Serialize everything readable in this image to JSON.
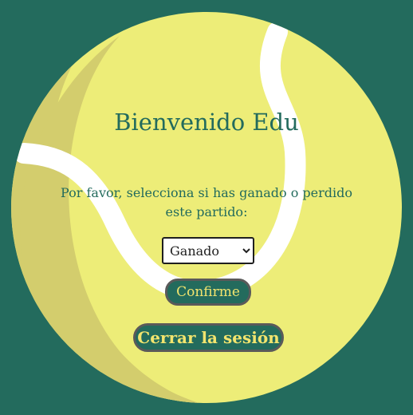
{
  "colors": {
    "background": "#236b5d",
    "ball_yellow": "#eded78",
    "ball_shadow": "#d3cd6d",
    "seam": "#ffffff",
    "text": "#236b5d",
    "button_text": "#f2e46e"
  },
  "icons": {
    "ball": "tennis-ball"
  },
  "welcome": {
    "title": "Bienvenido Edu"
  },
  "result": {
    "prompt": "Por favor, selecciona si has ganado o perdido este partido:",
    "selected_option": "Ganado",
    "options": [
      "Ganado"
    ]
  },
  "actions": {
    "confirm_label": "Confirme",
    "logout_label": "Cerrar la sesión"
  }
}
